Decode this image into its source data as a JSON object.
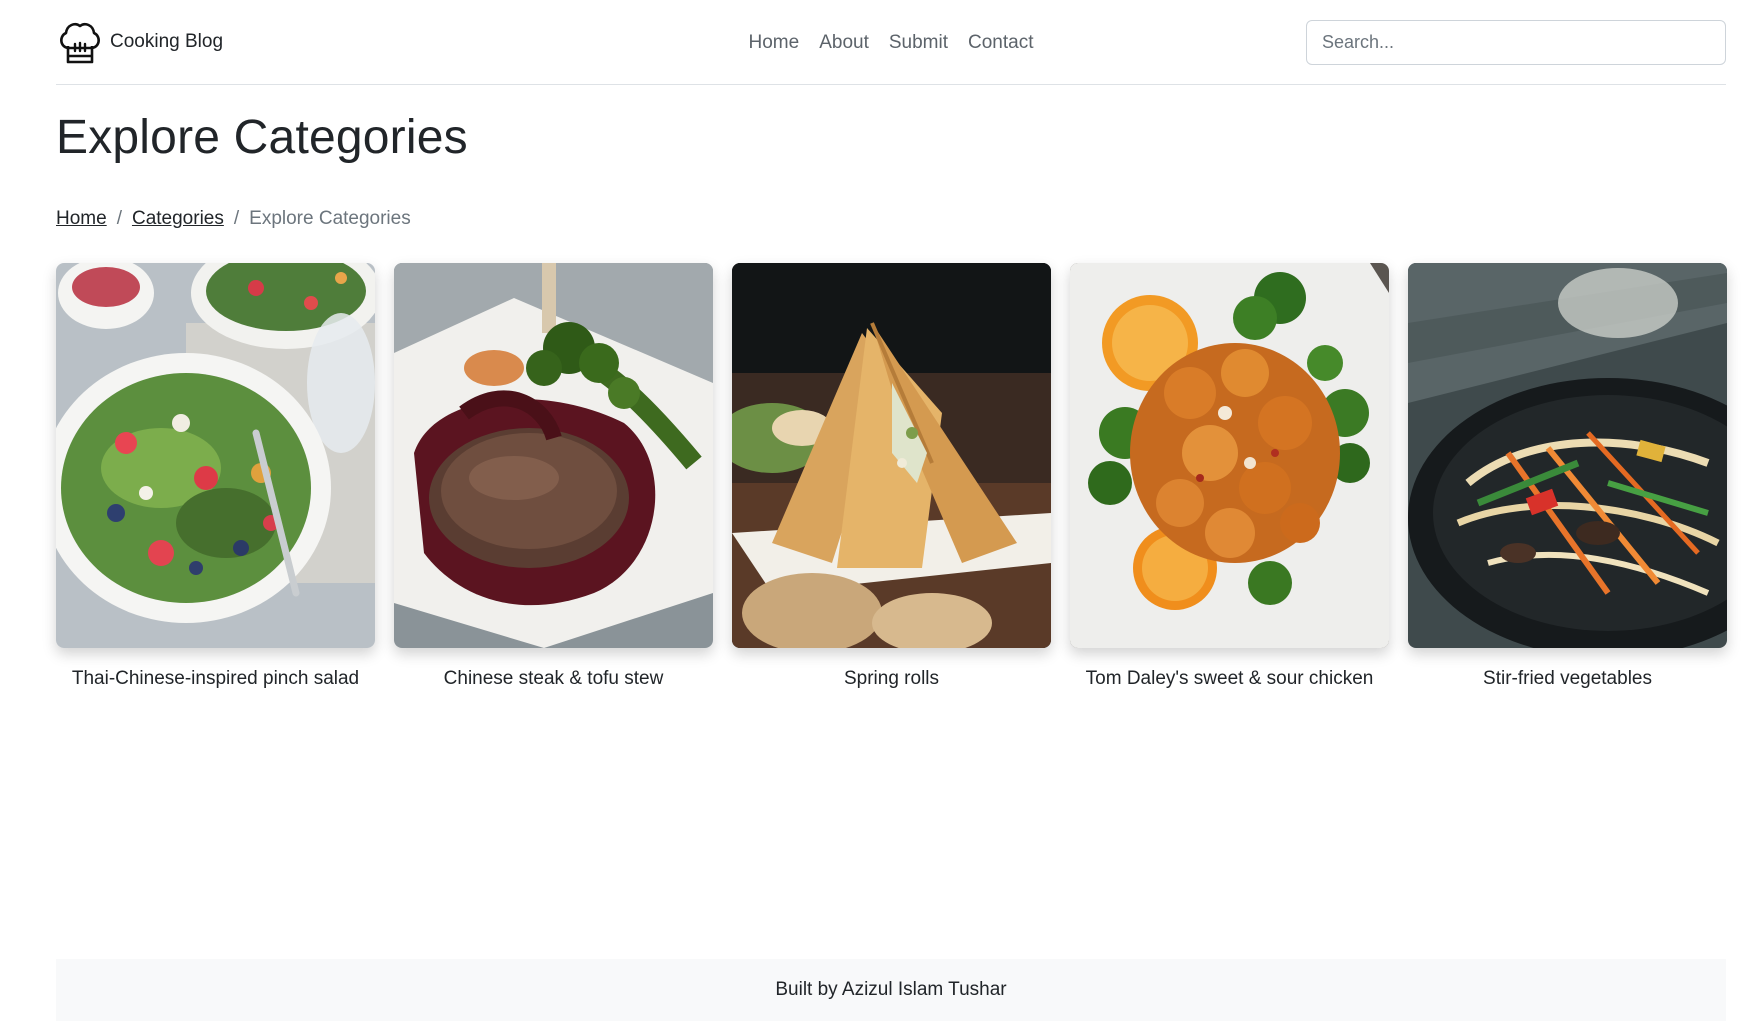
{
  "brand": {
    "name": "Cooking Blog",
    "icon": "chef-hat-icon"
  },
  "nav": {
    "items": [
      "Home",
      "About",
      "Submit",
      "Contact"
    ]
  },
  "search": {
    "placeholder": "Search...",
    "value": ""
  },
  "page": {
    "title": "Explore Categories"
  },
  "breadcrumb": {
    "items": [
      "Home",
      "Categories"
    ],
    "current": "Explore Categories"
  },
  "categories": [
    {
      "title": "Thai-Chinese-inspired pinch salad"
    },
    {
      "title": "Chinese steak & tofu stew"
    },
    {
      "title": "Spring rolls"
    },
    {
      "title": "Tom Daley's sweet & sour chicken"
    },
    {
      "title": "Stir-fried vegetables"
    }
  ],
  "footer": {
    "text": "Built by Azizul Islam Tushar"
  }
}
